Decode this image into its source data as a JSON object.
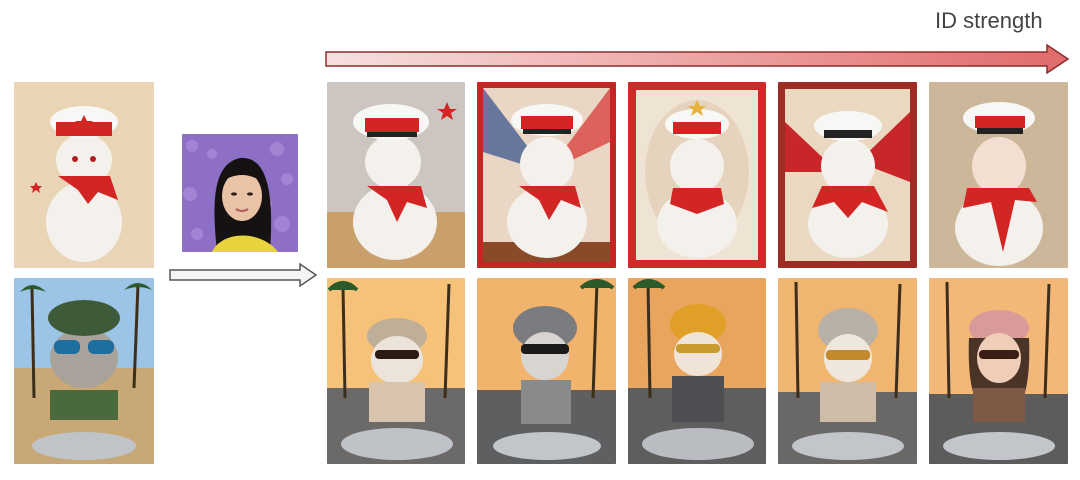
{
  "header": {
    "strength_label": "ID strength"
  },
  "colors": {
    "arrow_light": "#f7dcdc",
    "arrow_dark": "#e06b6b",
    "arrow_stroke": "#8a2f2f",
    "row1_bg": "#e8d4b4",
    "row2_bg": "#f3b36b",
    "cap_red": "#d42525",
    "fur_white": "#f3f0ec",
    "lavender": "#8b6cc4"
  },
  "grid": {
    "row1_theme": "white-cat-red-cap-scarf",
    "row2_theme": "cat-motorcycle-palms-sunset",
    "reference_photo": "woman-lavender-field",
    "columns": 5
  }
}
